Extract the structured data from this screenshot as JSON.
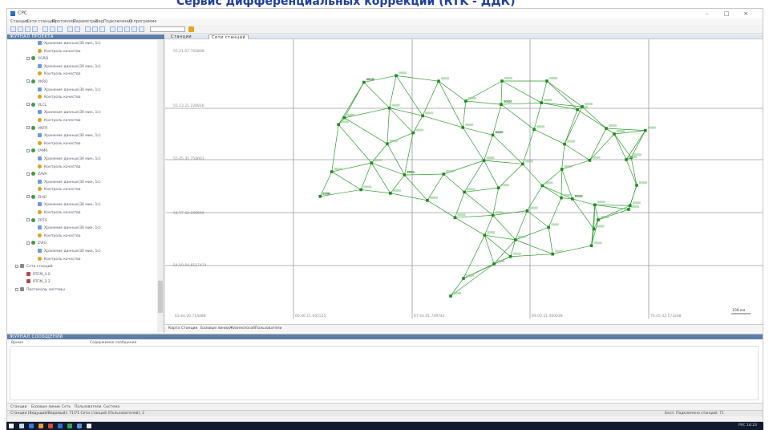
{
  "caption": "Сервис дифференциальных коррекций (RTK - ДДК)",
  "window": {
    "title": "СРС",
    "min": "–",
    "max": "□",
    "close": "×"
  },
  "menu": [
    "Станции",
    "Сети станций",
    "Протоколы",
    "Параметры",
    "Вид",
    "Подключения",
    "О программе"
  ],
  "left_panel": {
    "title": "ЖУРНАЛ ПРОЕКТА",
    "tree": [
      {
        "type": "file",
        "level": 3,
        "label": "Хранение данных(30 мин, 1с)"
      },
      {
        "type": "qc",
        "level": 3,
        "label": "Контроль качества"
      },
      {
        "type": "station",
        "level": 2,
        "label": "VGRD"
      },
      {
        "type": "file",
        "level": 3,
        "label": "Хранение данных(30 мин, 1с)"
      },
      {
        "type": "qc",
        "level": 3,
        "label": "Контроль качества"
      },
      {
        "type": "station",
        "level": 2,
        "label": "VKRD"
      },
      {
        "type": "file",
        "level": 3,
        "label": "Хранение данных(30 мин, 1с)"
      },
      {
        "type": "qc",
        "level": 3,
        "label": "Контроль качества"
      },
      {
        "type": "station",
        "level": 2,
        "label": "VLCL"
      },
      {
        "type": "file",
        "level": 3,
        "label": "Хранение данных(30 мин, 1с)"
      },
      {
        "type": "qc",
        "level": 3,
        "label": "Контроль качества"
      },
      {
        "type": "station",
        "level": 2,
        "label": "VNTR"
      },
      {
        "type": "file",
        "level": 3,
        "label": "Хранение данных(30 мин, 1с)"
      },
      {
        "type": "qc",
        "level": 3,
        "label": "Контроль качества"
      },
      {
        "type": "station",
        "level": 2,
        "label": "YAMR"
      },
      {
        "type": "file",
        "level": 3,
        "label": "Хранение данных(30 мин, 1с)"
      },
      {
        "type": "qc",
        "level": 3,
        "label": "Контроль качества"
      },
      {
        "type": "station",
        "level": 2,
        "label": "ZAVA"
      },
      {
        "type": "file",
        "level": 3,
        "label": "Хранение данных(30 мин, 1с)"
      },
      {
        "type": "qc",
        "level": 3,
        "label": "Контроль качества"
      },
      {
        "type": "station",
        "level": 2,
        "label": "ZHIG"
      },
      {
        "type": "file",
        "level": 3,
        "label": "Хранение данных(30 мин, 1с)"
      },
      {
        "type": "qc",
        "level": 3,
        "label": "Контроль качества"
      },
      {
        "type": "station",
        "level": 2,
        "label": "ZRTS"
      },
      {
        "type": "file",
        "level": 3,
        "label": "Хранение данных(30 мин, 1с)"
      },
      {
        "type": "qc",
        "level": 3,
        "label": "Контроль качества"
      },
      {
        "type": "station",
        "level": 2,
        "label": "ZVIG"
      },
      {
        "type": "file",
        "level": 3,
        "label": "Хранение данных(30 мин, 1с)"
      },
      {
        "type": "qc",
        "level": 3,
        "label": "Контроль качества"
      },
      {
        "type": "net",
        "level": 1,
        "label": "Сети станций"
      },
      {
        "type": "rtk",
        "level": 2,
        "label": "RTCM_3.0"
      },
      {
        "type": "rtk",
        "level": 2,
        "label": "RTCM_3.2"
      },
      {
        "type": "net",
        "level": 1,
        "label": "Протоколы системы"
      }
    ]
  },
  "map": {
    "tabs": [
      "Станции",
      "Сети станций"
    ],
    "h_labels": [
      "55.21.07.702808",
      "55.13.21.226816",
      "55.05.35.758003",
      "54.57.50.269999",
      "54.50.04.8117474"
    ],
    "v_labels": [
      "63.44.20.714488",
      "66.46.11.601515",
      "67.44.01.749742",
      "69.03.51.460039",
      "70.45.42.173268"
    ],
    "scale": "100 км",
    "bottom_tabs": [
      "Карта",
      "Станции",
      "Базовые линии",
      "Жизнеспособ",
      "Пользователи"
    ],
    "stations": [
      {
        "id": "s0",
        "label": "KRSN"
      },
      {
        "id": "s1",
        "label": "SOCH"
      },
      {
        "id": "s2",
        "label": "MXRF"
      },
      {
        "id": "s3",
        "label": "PXDL"
      },
      {
        "id": "s4",
        "label": "STRB"
      },
      {
        "id": "s5",
        "label": "RCH2"
      }
    ]
  },
  "messages": {
    "title": "ЖУРНАЛ СООБЩЕНИЙ",
    "columns": [
      "Время",
      "Содержимое сообщения"
    ]
  },
  "lower_tabs": [
    "Станции",
    "Базовые линии",
    "Сеть",
    "Пользователи",
    "Система"
  ],
  "status": {
    "left": "Станции (Ведущий/Ведомый): 71/71   Сети станций (Пользователей): 2",
    "right": "Бесп. Подключено станций: 71"
  },
  "taskbar": {
    "tray": "РУС  14:23"
  }
}
